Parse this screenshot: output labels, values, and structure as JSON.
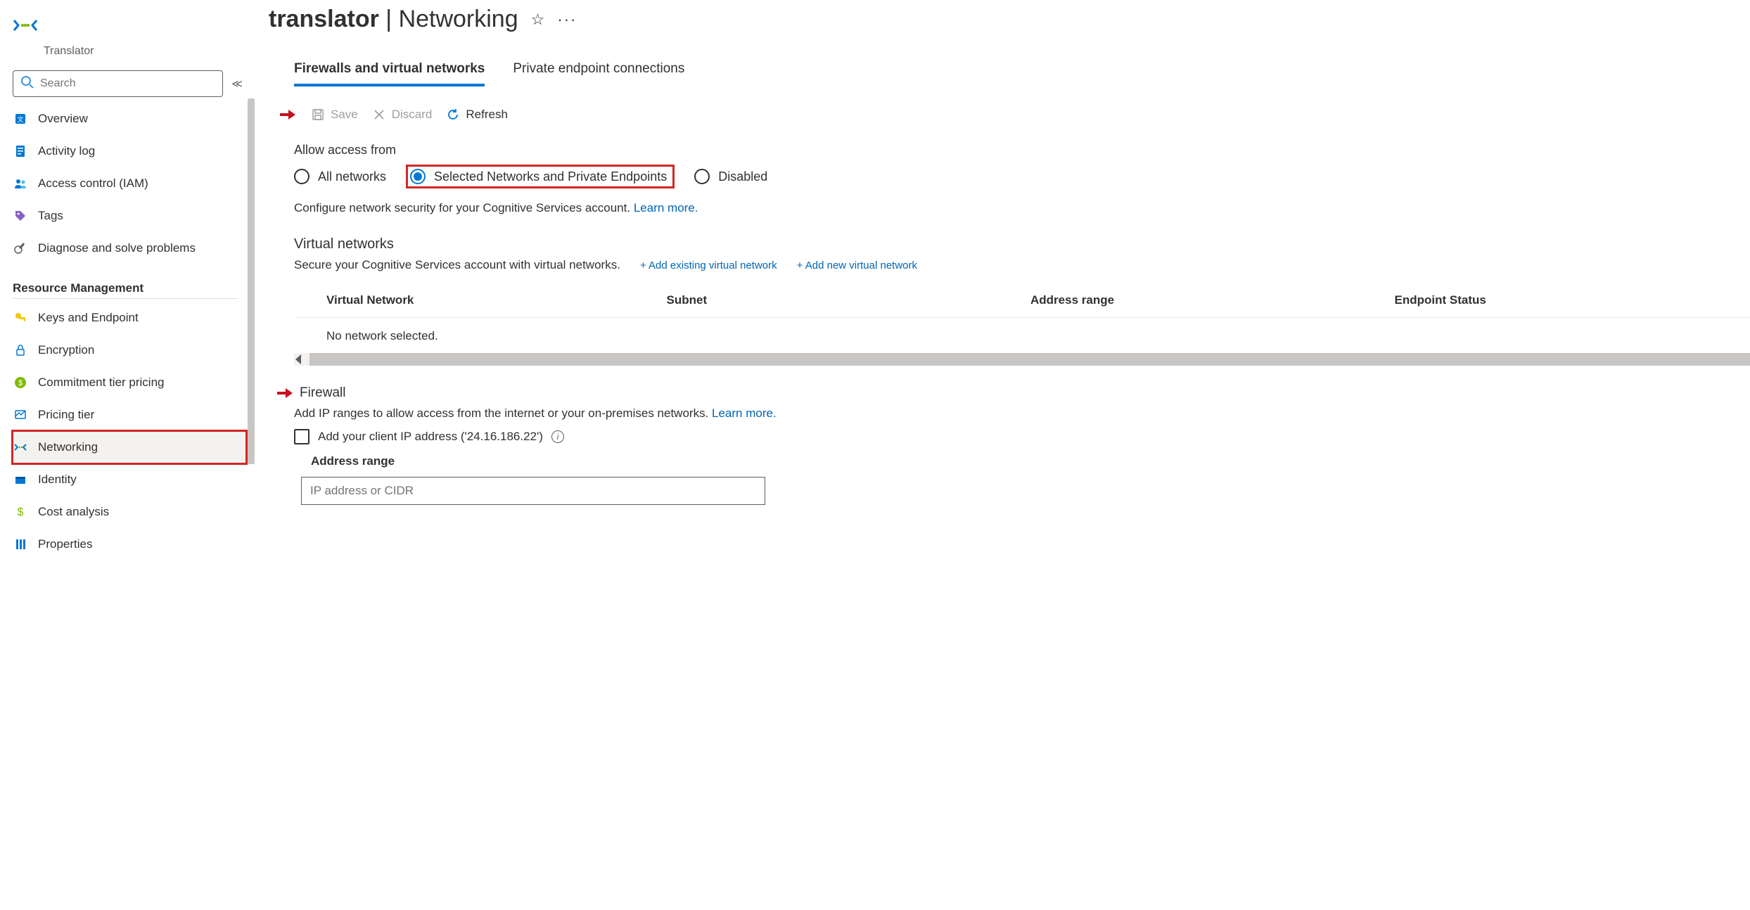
{
  "sidebar": {
    "resource_kind": "Translator",
    "search_placeholder": "Search",
    "items_top": [
      {
        "label": "Overview",
        "name": "overview"
      },
      {
        "label": "Activity log",
        "name": "activity-log"
      },
      {
        "label": "Access control (IAM)",
        "name": "access-control"
      },
      {
        "label": "Tags",
        "name": "tags"
      },
      {
        "label": "Diagnose and solve problems",
        "name": "diagnose"
      }
    ],
    "section_header": "Resource Management",
    "items_rm": [
      {
        "label": "Keys and Endpoint",
        "name": "keys-endpoint"
      },
      {
        "label": "Encryption",
        "name": "encryption"
      },
      {
        "label": "Commitment tier pricing",
        "name": "commitment-tier"
      },
      {
        "label": "Pricing tier",
        "name": "pricing-tier"
      },
      {
        "label": "Networking",
        "name": "networking",
        "active": true,
        "highlight": true
      },
      {
        "label": "Identity",
        "name": "identity"
      },
      {
        "label": "Cost analysis",
        "name": "cost-analysis"
      },
      {
        "label": "Properties",
        "name": "properties"
      }
    ]
  },
  "header": {
    "title_bold": "translator",
    "title_sep": " | ",
    "title_rest": "Networking"
  },
  "tabs": [
    {
      "label": "Firewalls and virtual networks",
      "active": true
    },
    {
      "label": "Private endpoint connections",
      "active": false
    }
  ],
  "toolbar": {
    "save": "Save",
    "discard": "Discard",
    "refresh": "Refresh"
  },
  "access": {
    "label": "Allow access from",
    "options": [
      {
        "label": "All networks",
        "selected": false,
        "highlight": false
      },
      {
        "label": "Selected Networks and Private Endpoints",
        "selected": true,
        "highlight": true
      },
      {
        "label": "Disabled",
        "selected": false,
        "highlight": false
      }
    ],
    "help_prefix": "Configure network security for your Cognitive Services account. ",
    "learn_more": "Learn more."
  },
  "vnets": {
    "title": "Virtual networks",
    "subtitle": "Secure your Cognitive Services account with virtual networks.",
    "add_existing": "Add existing virtual network",
    "add_new": "Add new virtual network",
    "columns": [
      "Virtual Network",
      "Subnet",
      "Address range",
      "Endpoint Status"
    ],
    "empty": "No network selected."
  },
  "firewall": {
    "title": "Firewall",
    "help_prefix": "Add IP ranges to allow access from the internet or your on-premises networks. ",
    "learn_more": "Learn more.",
    "client_ip_label": "Add your client IP address ('24.16.186.22')",
    "address_range_label": "Address range",
    "input_placeholder": "IP address or CIDR"
  }
}
